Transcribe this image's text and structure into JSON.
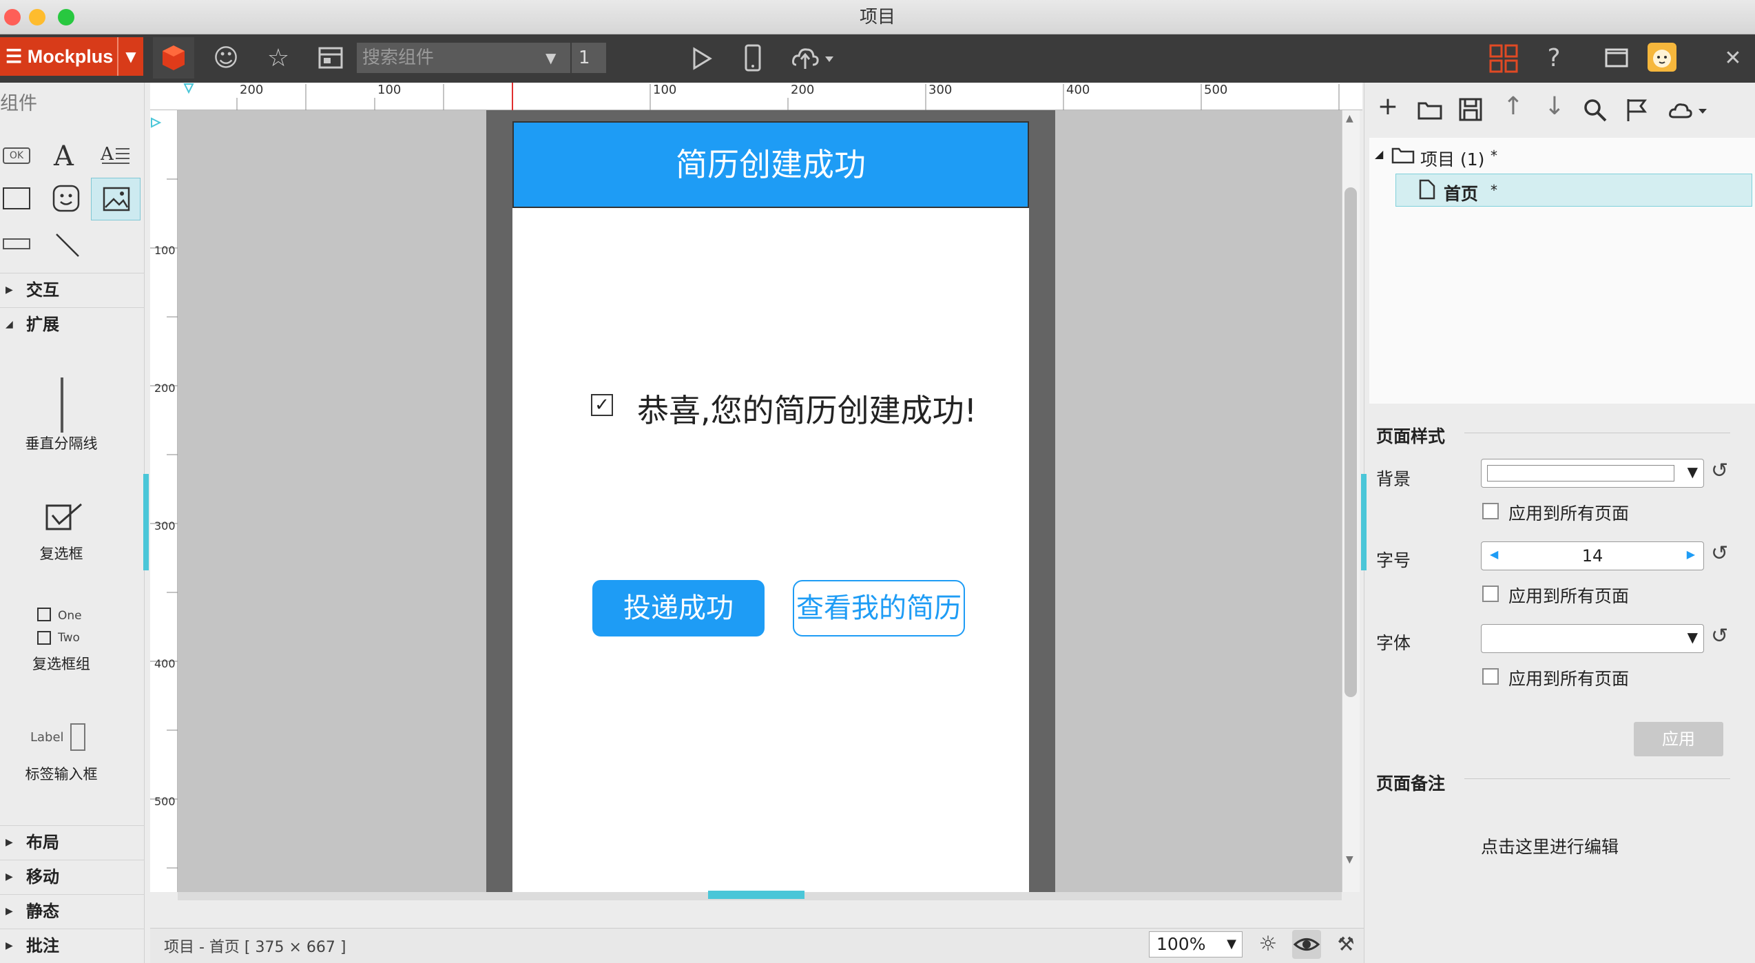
{
  "window": {
    "title": "项目"
  },
  "toolbar": {
    "brand": "Mockplus",
    "search_placeholder": "搜索组件",
    "page_number": "1",
    "icons": [
      "box-icon",
      "emoji-icon",
      "star-icon",
      "layout-icon",
      "play-icon",
      "phone-icon",
      "cloud-upload-icon",
      "grid-icon",
      "help-icon",
      "window-icon",
      "avatar-icon",
      "close-icon"
    ]
  },
  "left": {
    "title": "组件",
    "sections": {
      "interaction": "交互",
      "extension": "扩展",
      "layout": "布局",
      "mobile": "移动",
      "static": "静态",
      "annotation": "批注"
    },
    "ext_items": {
      "vdivider": "垂直分隔线",
      "checkbox": "复选框",
      "checkbox_group": "复选框组",
      "label_input": "标签输入框",
      "one": "One",
      "two": "Two",
      "label": "Label"
    }
  },
  "rulers": {
    "h": [
      "200",
      "100",
      "100",
      "200",
      "300",
      "400",
      "500"
    ],
    "v": [
      "100",
      "200",
      "300",
      "400",
      "500"
    ]
  },
  "phone": {
    "header": "简历创建成功",
    "message": "恭喜,您的简历创建成功!",
    "btn_primary": "投递成功",
    "btn_secondary": "查看我的简历"
  },
  "status": {
    "text": "项目 - 首页 [ 375 × 667 ]",
    "zoom": "100%"
  },
  "right": {
    "tree": {
      "project": "项目 (1)",
      "page": "首页",
      "mark": "*"
    },
    "page_style": "页面样式",
    "background": "背景",
    "apply_all": "应用到所有页面",
    "font_size_label": "字号",
    "font_size": "14",
    "font_label": "字体",
    "apply": "应用",
    "notes_title": "页面备注",
    "notes_placeholder": "点击这里进行编辑"
  },
  "colors": {
    "brand": "#d83b19",
    "accent": "#1e9cf5",
    "highlight": "#4ac6d8"
  }
}
